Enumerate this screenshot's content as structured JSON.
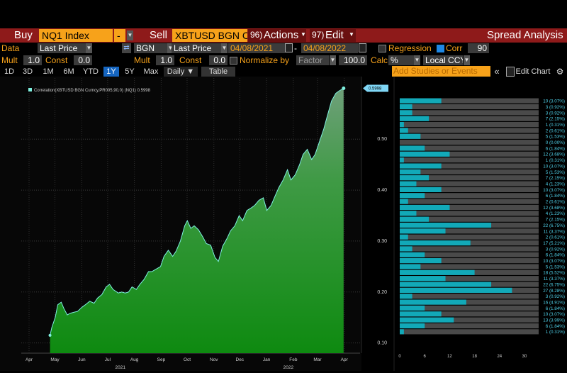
{
  "header": {
    "buy_label": "Buy",
    "buy_ticker": "NQ1 Index",
    "minus": "-",
    "sell_label": "Sell",
    "sell_ticker": "XBTUSD BGN C",
    "actions_num": "96)",
    "actions_label": "Actions",
    "edit_num": "97)",
    "edit_label": "Edit",
    "title": "Spread Analysis"
  },
  "settings": {
    "data_label": "Data",
    "data_field": "Last Price",
    "source": "BGN",
    "field2": "Last Price",
    "start_date": "04/08/2021",
    "date_sep": "-",
    "end_date": "04/08/2022",
    "regression_label": "Regression",
    "regression_checked": false,
    "corr_label": "Corr",
    "corr_checked": true,
    "corr_window": "90",
    "mult_label": "Mult",
    "mult1": "1.0",
    "const_label": "Const",
    "const1": "0.0",
    "mult2_label": "Mult",
    "mult2": "1.0",
    "const2_label": "Const",
    "const2": "0.0",
    "normalize_label": "Normalize by",
    "normalize_checked": false,
    "factor_label": "Factor",
    "factor_value": "100.0",
    "calc_label": "Calc",
    "calc_value": "%",
    "ccy_value": "Local CCY"
  },
  "toolbar": {
    "ranges": [
      "1D",
      "3D",
      "1M",
      "6M",
      "YTD",
      "1Y",
      "5Y",
      "Max"
    ],
    "selected": "1Y",
    "frequency": "Daily ▼",
    "table_label": "Table",
    "studies_placeholder": "Add Studies or Events",
    "collapse_icon": "«",
    "edit_chart_label": "Edit Chart",
    "gear_icon": "⚙"
  },
  "chart_data": [
    {
      "type": "area",
      "legend": "Correlation(XBTUSD BGN Curncy,PR005,90,0) (NQ1) 0.5998",
      "last_value_label": "0.5998",
      "last_value": 0.5998,
      "ylim": [
        0.08,
        0.62
      ],
      "yticks": [
        "0.10",
        "0.20",
        "0.30",
        "0.40",
        "0.50"
      ],
      "x_months": [
        "Apr",
        "May",
        "Jun",
        "Jul",
        "Aug",
        "Sep",
        "Oct",
        "Nov",
        "Dec",
        "Jan",
        "Feb",
        "Mar",
        "Apr"
      ],
      "x_years": [
        "2021",
        "2022"
      ],
      "series_color": "#2fae3a",
      "points": [
        [
          "2021-05-01",
          0.115
        ],
        [
          "2021-05-03",
          0.13
        ],
        [
          "2021-05-07",
          0.15
        ],
        [
          "2021-05-10",
          0.175
        ],
        [
          "2021-05-14",
          0.18
        ],
        [
          "2021-05-17",
          0.168
        ],
        [
          "2021-05-21",
          0.155
        ],
        [
          "2021-05-24",
          0.158
        ],
        [
          "2021-05-28",
          0.16
        ],
        [
          "2021-06-02",
          0.162
        ],
        [
          "2021-06-07",
          0.17
        ],
        [
          "2021-06-11",
          0.175
        ],
        [
          "2021-06-16",
          0.182
        ],
        [
          "2021-06-21",
          0.178
        ],
        [
          "2021-06-25",
          0.188
        ],
        [
          "2021-06-30",
          0.195
        ],
        [
          "2021-07-05",
          0.21
        ],
        [
          "2021-07-09",
          0.215
        ],
        [
          "2021-07-13",
          0.205
        ],
        [
          "2021-07-19",
          0.198
        ],
        [
          "2021-07-23",
          0.2
        ],
        [
          "2021-07-27",
          0.198
        ],
        [
          "2021-07-31",
          0.2
        ],
        [
          "2021-08-04",
          0.21
        ],
        [
          "2021-08-09",
          0.205
        ],
        [
          "2021-08-13",
          0.215
        ],
        [
          "2021-08-18",
          0.225
        ],
        [
          "2021-08-23",
          0.24
        ],
        [
          "2021-08-27",
          0.24
        ],
        [
          "2021-09-01",
          0.245
        ],
        [
          "2021-09-06",
          0.25
        ],
        [
          "2021-09-10",
          0.27
        ],
        [
          "2021-09-15",
          0.282
        ],
        [
          "2021-09-20",
          0.27
        ],
        [
          "2021-09-24",
          0.28
        ],
        [
          "2021-09-29",
          0.3
        ],
        [
          "2021-10-04",
          0.33
        ],
        [
          "2021-10-07",
          0.34
        ],
        [
          "2021-10-11",
          0.325
        ],
        [
          "2021-10-15",
          0.33
        ],
        [
          "2021-10-20",
          0.322
        ],
        [
          "2021-10-25",
          0.308
        ],
        [
          "2021-10-29",
          0.295
        ],
        [
          "2021-11-03",
          0.292
        ],
        [
          "2021-11-08",
          0.268
        ],
        [
          "2021-11-12",
          0.26
        ],
        [
          "2021-11-17",
          0.29
        ],
        [
          "2021-11-22",
          0.305
        ],
        [
          "2021-11-26",
          0.32
        ],
        [
          "2021-12-01",
          0.33
        ],
        [
          "2021-12-06",
          0.35
        ],
        [
          "2021-12-10",
          0.34
        ],
        [
          "2021-12-15",
          0.36
        ],
        [
          "2021-12-20",
          0.365
        ],
        [
          "2021-12-24",
          0.37
        ],
        [
          "2021-12-29",
          0.38
        ],
        [
          "2022-01-03",
          0.385
        ],
        [
          "2022-01-07",
          0.36
        ],
        [
          "2022-01-12",
          0.37
        ],
        [
          "2022-01-17",
          0.39
        ],
        [
          "2022-01-21",
          0.405
        ],
        [
          "2022-01-26",
          0.42
        ],
        [
          "2022-01-31",
          0.44
        ],
        [
          "2022-02-04",
          0.42
        ],
        [
          "2022-02-09",
          0.43
        ],
        [
          "2022-02-14",
          0.45
        ],
        [
          "2022-02-18",
          0.47
        ],
        [
          "2022-02-23",
          0.48
        ],
        [
          "2022-02-28",
          0.46
        ],
        [
          "2022-03-04",
          0.47
        ],
        [
          "2022-03-09",
          0.495
        ],
        [
          "2022-03-14",
          0.52
        ],
        [
          "2022-03-18",
          0.545
        ],
        [
          "2022-03-23",
          0.575
        ],
        [
          "2022-03-28",
          0.59
        ],
        [
          "2022-04-01",
          0.595
        ],
        [
          "2022-04-06",
          0.5998
        ]
      ]
    },
    {
      "type": "bar",
      "orientation": "horizontal",
      "xlim": [
        0,
        30
      ],
      "xticks": [
        "0",
        "6",
        "12",
        "18",
        "24",
        "30"
      ],
      "counts": [
        10,
        3,
        3,
        7,
        1,
        2,
        5,
        0,
        6,
        12,
        1,
        10,
        5,
        7,
        4,
        10,
        6,
        2,
        12,
        4,
        7,
        22,
        11,
        2,
        17,
        3,
        6,
        10,
        5,
        18,
        11,
        22,
        27,
        3,
        16,
        6,
        10,
        13,
        6,
        1
      ],
      "labels": [
        "10 (3.07%)",
        "3 (0.92%)",
        "3 (0.92%)",
        "7 (2.15%)",
        "1 (0.31%)",
        "2 (0.61%)",
        "5 (1.53%)",
        "0 (0.00%)",
        "6 (1.84%)",
        "12 (3.68%)",
        "1 (0.31%)",
        "10 (3.07%)",
        "5 (1.53%)",
        "7 (2.15%)",
        "4 (1.23%)",
        "10 (3.07%)",
        "6 (1.84%)",
        "2 (0.61%)",
        "12 (3.68%)",
        "4 (1.23%)",
        "7 (2.15%)",
        "22 (6.75%)",
        "11 (3.37%)",
        "2 (0.61%)",
        "17 (5.21%)",
        "3 (0.92%)",
        "6 (1.84%)",
        "10 (3.07%)",
        "5 (1.53%)",
        "18 (5.52%)",
        "11 (3.37%)",
        "22 (6.75%)",
        "27 (8.28%)",
        "3 (0.92%)",
        "16 (4.91%)",
        "6 (1.84%)",
        "10 (3.07%)",
        "13 (3.99%)",
        "6 (1.84%)",
        "1 (0.31%)"
      ]
    }
  ]
}
